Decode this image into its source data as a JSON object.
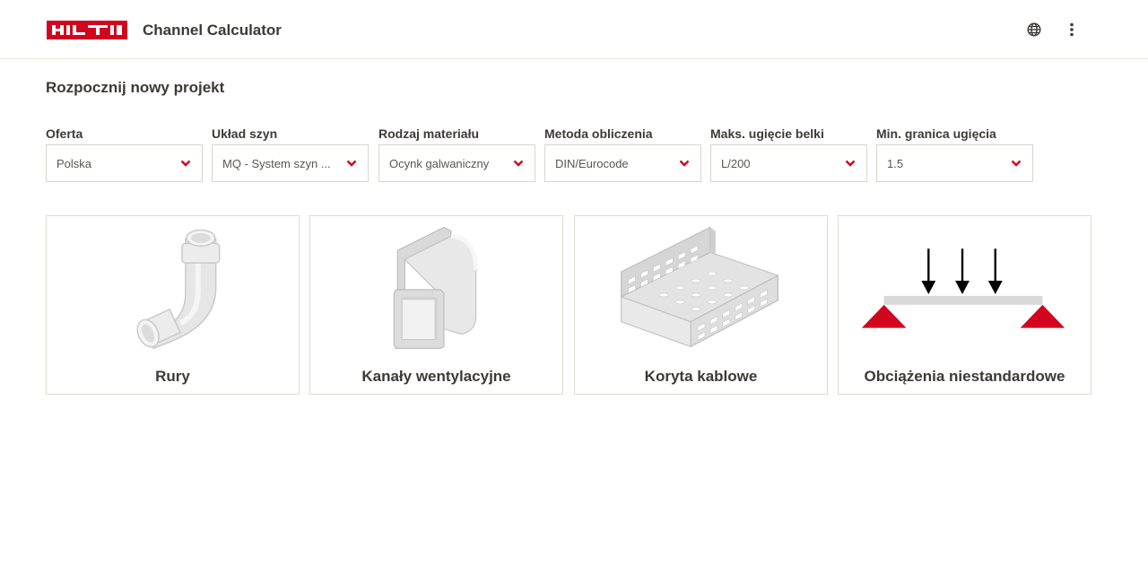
{
  "header": {
    "logo_text": "HILTI",
    "title": "Channel Calculator",
    "globe_icon": "globe-icon",
    "more_icon": "more-vertical-icon"
  },
  "main": {
    "title": "Rozpocznij nowy projekt",
    "filters": [
      {
        "label": "Oferta",
        "value": "Polska"
      },
      {
        "label": "Układ szyn",
        "value": "MQ - System szyn ..."
      },
      {
        "label": "Rodzaj materiału",
        "value": "Ocynk galwaniczny"
      },
      {
        "label": "Metoda obliczenia",
        "value": "DIN/Eurocode"
      },
      {
        "label": "Maks. ugięcie belki",
        "value": "L/200"
      },
      {
        "label": "Min. granica ugięcia",
        "value": "1.5"
      }
    ],
    "cards": [
      {
        "label": "Rury",
        "icon": "pipe-elbow-icon"
      },
      {
        "label": "Kanały wentylacyjne",
        "icon": "ventilation-duct-icon"
      },
      {
        "label": "Koryta kablowe",
        "icon": "cable-tray-icon"
      },
      {
        "label": "Obciążenia niestandardowe",
        "icon": "custom-load-icon"
      }
    ]
  },
  "colors": {
    "brand_red": "#d2051e",
    "text": "#3d3a36",
    "border": "#d8d5c9"
  }
}
